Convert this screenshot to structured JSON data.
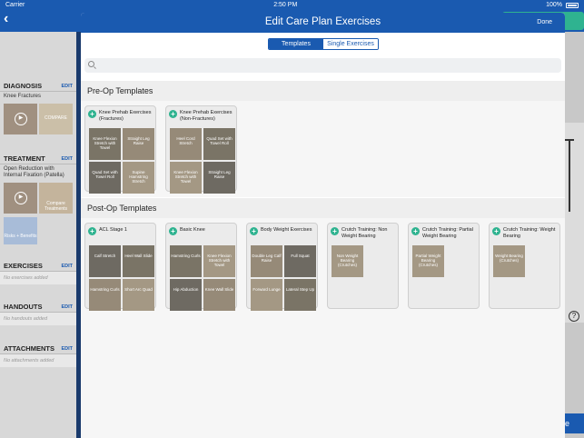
{
  "statusbar": {
    "carrier": "Carrier",
    "time": "2:50 PM",
    "battery": "100%"
  },
  "sidebar": {
    "diagnosis": {
      "title": "DIAGNOSIS",
      "edit": "EDIT",
      "text": "Knee Fractures",
      "compare": "COMPARE"
    },
    "treatment": {
      "title": "TREATMENT",
      "edit": "EDIT",
      "text": "Open Reduction with Internal Fixation (Patella)",
      "compare": "Compare Treatments",
      "risks": "Risks + Benefits"
    },
    "exercises": {
      "title": "EXERCISES",
      "edit": "EDIT",
      "empty": "No exercises added"
    },
    "handouts": {
      "title": "HANDOUTS",
      "edit": "EDIT",
      "empty": "No handouts added"
    },
    "attachments": {
      "title": "ATTACHMENTS",
      "edit": "EDIT",
      "empty": "No attachments added"
    }
  },
  "modal": {
    "title": "Edit Care Plan Exercises",
    "done": "Done",
    "tabs": [
      "Templates",
      "Single Exercises"
    ],
    "preop_title": "Pre-Op Templates",
    "postop_title": "Post-Op Templates",
    "preop": [
      {
        "name": "Knee Prehab Exercises (Fractures)",
        "exercises": [
          "Knee Flexion Stretch with Towel",
          "Straight Leg Raise",
          "Quad Set with Towel Roll",
          "Supine Hamstring Stretch"
        ]
      },
      {
        "name": "Knee Prehab Exercises (Non-Fractures)",
        "exercises": [
          "Heel Cord Stretch",
          "Quad Set with Towel Roll",
          "Knee Flexion Stretch with Towel",
          "Straight Leg Raise"
        ]
      }
    ],
    "postop": [
      {
        "name": "ACL Stage 1",
        "exercises": [
          "Calf Stretch",
          "Heel Wall Slide",
          "Hamstring Curls",
          "Short Arc Quad"
        ]
      },
      {
        "name": "Basic Knee",
        "exercises": [
          "Hamstring Curls",
          "Knee Flexion Stretch with Towel",
          "Hip Abduction",
          "Knee Wall Slide"
        ]
      },
      {
        "name": "Body Weight Exercises",
        "exercises": [
          "Double Leg Calf Raise",
          "Full Squat",
          "Forward Lunge",
          "Lateral Step Up"
        ]
      },
      {
        "name": "Crutch Training: Non Weight Bearing",
        "exercises": [
          "Non Weight Bearing (Crutches)"
        ]
      },
      {
        "name": "Crutch Training: Partial Weight Bearing",
        "exercises": [
          "Partial Weight Bearing (Crutches)"
        ]
      },
      {
        "name": "Crutch Training: Weight Bearing",
        "exercises": [
          "Weight Bearing (Crutches)"
        ]
      }
    ]
  },
  "background": {
    "bottom_button": "e",
    "help": "?"
  }
}
